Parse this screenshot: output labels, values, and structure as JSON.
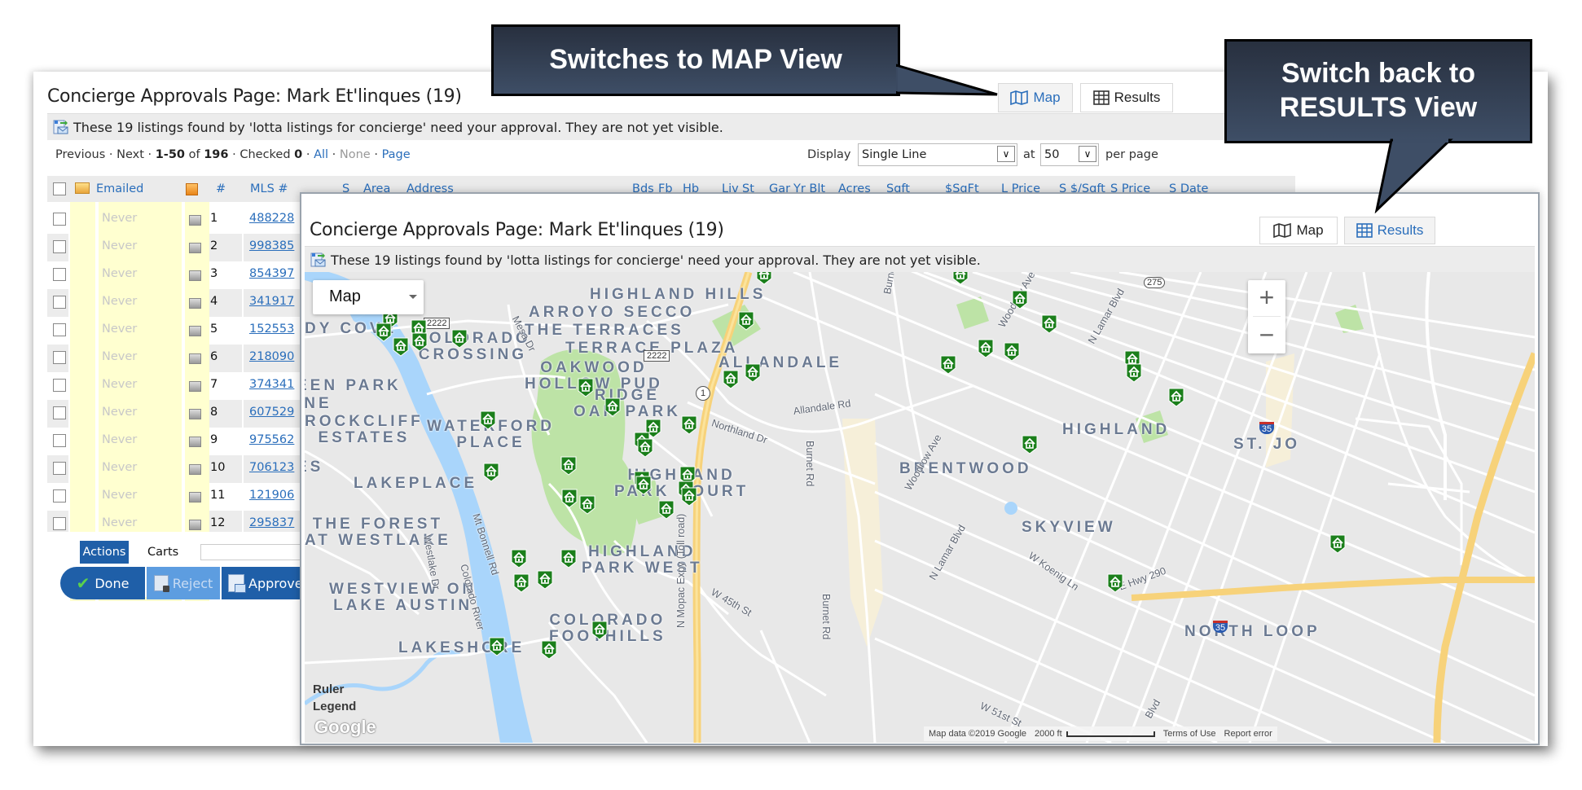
{
  "callouts": {
    "map": "Switches to MAP View",
    "results_line1": "Switch back to",
    "results_line2": "RESULTS View"
  },
  "back_page": {
    "title": "Concierge Approvals Page: Mark Et'linques (19)",
    "view_buttons": {
      "map": "Map",
      "results": "Results",
      "active": "map"
    },
    "info": "These 19 listings found by 'lotta listings for concierge' need your approval. They are not yet visible.",
    "pager": {
      "previous": "Previous",
      "next": "Next",
      "range": "1-50",
      "of": "of",
      "total": "196",
      "checked_label": "Checked",
      "checked": "0",
      "all": "All",
      "none": "None",
      "page": "Page",
      "sep": "·",
      "display_label": "Display",
      "display_value": "Single Line",
      "at_label": "at",
      "per_page_value": "50",
      "per_page_label": "per page"
    },
    "columns": [
      "Emailed",
      "#",
      "MLS #",
      "S",
      "Area",
      "Address",
      "Bds",
      "Fb",
      "Hb",
      "Liv",
      "St",
      "Gar",
      "Yr Blt",
      "Acres",
      "Sqft",
      "$SqFt",
      "L Price",
      "S $/Sqft",
      "S Price",
      "S Date"
    ],
    "rows": [
      {
        "emailed": "Never",
        "num": "1",
        "mls": "488228"
      },
      {
        "emailed": "Never",
        "num": "2",
        "mls": "998385"
      },
      {
        "emailed": "Never",
        "num": "3",
        "mls": "854397"
      },
      {
        "emailed": "Never",
        "num": "4",
        "mls": "341917"
      },
      {
        "emailed": "Never",
        "num": "5",
        "mls": "152553"
      },
      {
        "emailed": "Never",
        "num": "6",
        "mls": "218090"
      },
      {
        "emailed": "Never",
        "num": "7",
        "mls": "374341"
      },
      {
        "emailed": "Never",
        "num": "8",
        "mls": "607529"
      },
      {
        "emailed": "Never",
        "num": "9",
        "mls": "975562"
      },
      {
        "emailed": "Never",
        "num": "10",
        "mls": "706123"
      },
      {
        "emailed": "Never",
        "num": "11",
        "mls": "121906"
      },
      {
        "emailed": "Never",
        "num": "12",
        "mls": "295837"
      }
    ],
    "action_tabs": {
      "actions": "Actions",
      "carts": "Carts"
    },
    "action_buttons": {
      "done": "Done",
      "reject": "Reject",
      "approve": "Approve"
    }
  },
  "front_page": {
    "title": "Concierge Approvals Page: Mark Et'linques (19)",
    "view_buttons": {
      "map": "Map",
      "results": "Results",
      "active": "results"
    },
    "info": "These 19 listings found by 'lotta listings for concierge' need your approval. They are not yet visible.",
    "map": {
      "type_select": "Map",
      "zoom_in": "+",
      "zoom_out": "−",
      "ruler": "Ruler",
      "legend": "Legend",
      "google": "Google",
      "attribution": "Map data ©2019 Google",
      "scale": "2000 ft",
      "terms": "Terms of Use",
      "report": "Report  error",
      "areas": [
        {
          "name": "HIGHLAND HILLS"
        },
        {
          "name": "ARROYO SECCO"
        },
        {
          "name": "THE TERRACES"
        },
        {
          "name": "TERRACE PLAZA"
        },
        {
          "name": "DY COVE"
        },
        {
          "name": "COLORADO\nCROSSING"
        },
        {
          "name": "OAKWOOD\nHOLLOW PUD"
        },
        {
          "name": "ALLANDALE"
        },
        {
          "name": "EEN PARK"
        },
        {
          "name": "INE"
        },
        {
          "name": "ROCKCLIFF\nESTATES"
        },
        {
          "name": "WATERFORD\nPLACE"
        },
        {
          "name": "RIDGE\nOAK PARK"
        },
        {
          "name": "ES"
        },
        {
          "name": "LAKEPLACE"
        },
        {
          "name": "HIGHLAND\nPARK COURT"
        },
        {
          "name": "THE FOREST\nAT WESTLAKE"
        },
        {
          "name": "HIGHLAND\nPARK WEST"
        },
        {
          "name": "WESTVIEW ON\nLAKE AUSTIN"
        },
        {
          "name": "COLORADO\nFOOTHILLS"
        },
        {
          "name": "LAKESHORE"
        },
        {
          "name": "BRENTWOOD"
        },
        {
          "name": "HIGHLAND"
        },
        {
          "name": "ST. JO"
        },
        {
          "name": "SKYVIEW"
        },
        {
          "name": "NORTH LOOP"
        }
      ],
      "streets": [
        "Mesa Dr",
        "Northland Dr",
        "Allandale Rd",
        "Burnet Rd",
        "Burnet Rd",
        "Woodrow Ave",
        "Woodrow Ave",
        "N Lamar Blvd",
        "N Lamar Blvd",
        "W Koenig Ln",
        "E Hwy 290",
        "Mt Bonnell Rd",
        "Westlake Dr",
        "Colorado River",
        "N Mopac Expy (Toll road)",
        "W 45th St",
        "W 51st St",
        "Burnet",
        "Blvd"
      ],
      "shields": [
        "2222",
        "2222",
        "1",
        "275",
        "35",
        "35"
      ]
    }
  }
}
